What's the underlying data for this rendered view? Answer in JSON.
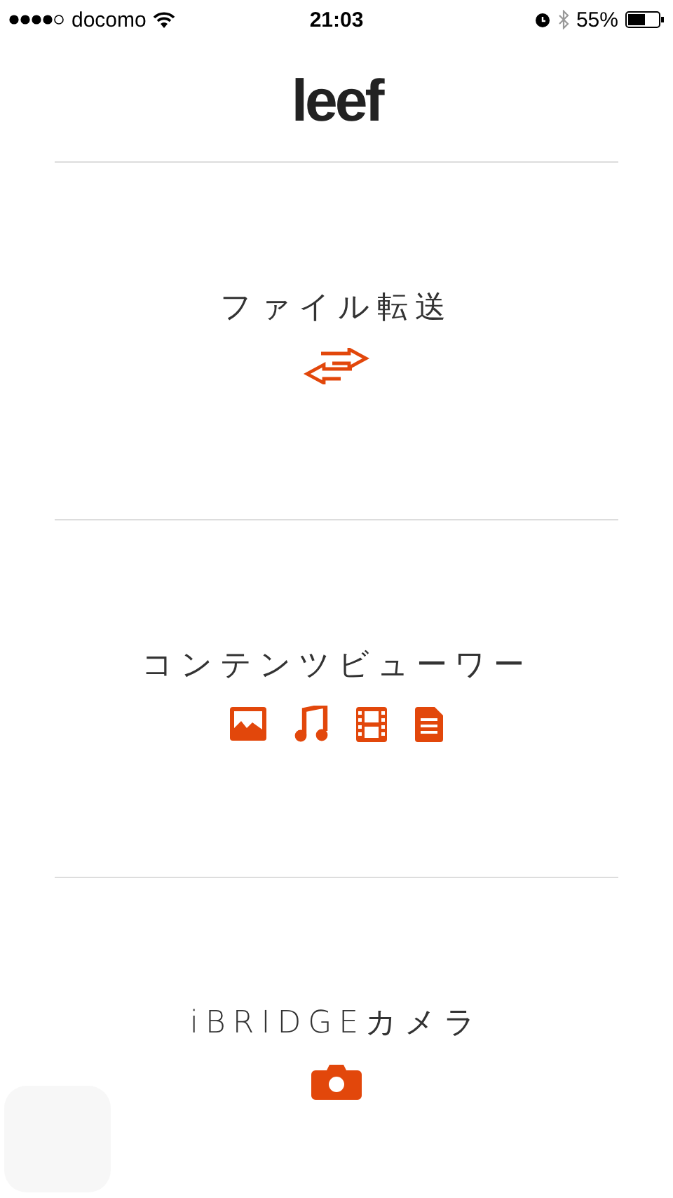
{
  "status_bar": {
    "carrier": "docomo",
    "time": "21:03",
    "battery": "55%"
  },
  "logo": "leef",
  "sections": [
    {
      "title": "ファイル転送",
      "icons": [
        {
          "kind": "transfer"
        }
      ]
    },
    {
      "title": "コンテンツビューワー",
      "icons": [
        {
          "kind": "image"
        },
        {
          "kind": "music"
        },
        {
          "kind": "video"
        },
        {
          "kind": "document"
        }
      ]
    },
    {
      "title": "iBRIDGEカメラ",
      "icons": [
        {
          "kind": "camera"
        }
      ]
    }
  ]
}
